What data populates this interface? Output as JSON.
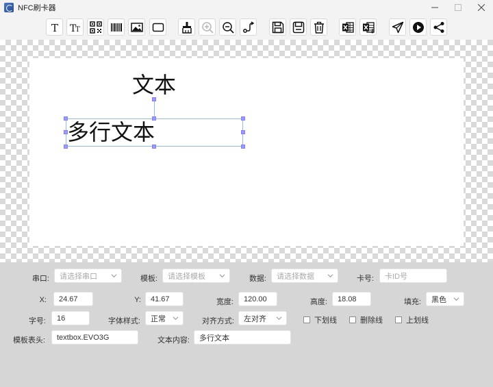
{
  "window": {
    "title": "NFC刷卡器"
  },
  "toolbar": {
    "buttons": [
      {
        "name": "text-tool-button",
        "icon": "text-icon"
      },
      {
        "name": "multiline-text-tool-button",
        "icon": "multiline-text-icon"
      },
      {
        "name": "qrcode-tool-button",
        "icon": "qrcode-icon"
      },
      {
        "name": "barcode-tool-button",
        "icon": "barcode-icon"
      },
      {
        "name": "image-tool-button",
        "icon": "image-icon"
      },
      {
        "name": "rectangle-tool-button",
        "icon": "rectangle-icon"
      },
      {
        "name": "clear-button",
        "icon": "brush-icon"
      },
      {
        "name": "zoom-in-button",
        "icon": "zoom-in-icon"
      },
      {
        "name": "zoom-out-button",
        "icon": "zoom-out-icon"
      },
      {
        "name": "route-button",
        "icon": "route-icon"
      },
      {
        "name": "save-button",
        "icon": "save-icon"
      },
      {
        "name": "save-as-button",
        "icon": "save-as-icon"
      },
      {
        "name": "delete-button",
        "icon": "trash-icon"
      },
      {
        "name": "excel-import-button",
        "icon": "excel-icon"
      },
      {
        "name": "excel-export-button",
        "icon": "excel-export-icon"
      },
      {
        "name": "send-button",
        "icon": "send-icon"
      },
      {
        "name": "play-button",
        "icon": "play-icon"
      },
      {
        "name": "share-button",
        "icon": "share-icon"
      }
    ]
  },
  "canvas": {
    "elements": [
      {
        "text": "文本"
      },
      {
        "text": "多行文本"
      }
    ]
  },
  "form": {
    "port": {
      "label": "串口:",
      "placeholder": "请选择串口"
    },
    "template": {
      "label": "模板:",
      "placeholder": "请选择模板"
    },
    "data": {
      "label": "数据:",
      "placeholder": "请选择数据"
    },
    "card_no": {
      "label": "卡号:",
      "placeholder": "卡ID号"
    },
    "x": {
      "label": "X:",
      "value": "24.67"
    },
    "y": {
      "label": "Y:",
      "value": "41.67"
    },
    "width": {
      "label": "宽度:",
      "value": "120.00"
    },
    "height": {
      "label": "高度:",
      "value": "18.08"
    },
    "fill": {
      "label": "填充:",
      "value": "黑色"
    },
    "font_size": {
      "label": "字号:",
      "value": "16"
    },
    "font_style": {
      "label": "字体样式:",
      "value": "正常"
    },
    "align": {
      "label": "对齐方式:",
      "value": "左对齐"
    },
    "underline": {
      "label": "下划线",
      "checked": false
    },
    "strikethrough": {
      "label": "删除线",
      "checked": false
    },
    "overline": {
      "label": "上划线",
      "checked": false
    },
    "template_header": {
      "label": "模板表头:",
      "value": "textbox.EVO3G"
    },
    "text_content": {
      "label": "文本内容:",
      "value": "多行文本"
    }
  }
}
